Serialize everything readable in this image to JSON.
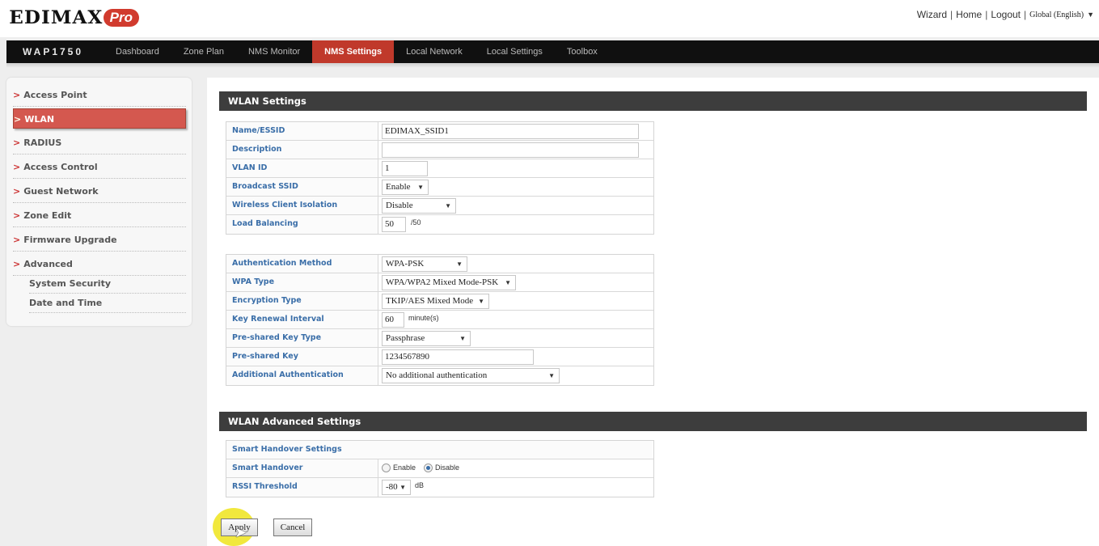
{
  "brand": {
    "name": "EDIMAX",
    "badge": "Pro",
    "brand_color": "#d13b2e"
  },
  "top_links": {
    "wizard": "Wizard",
    "home": "Home",
    "logout": "Logout",
    "separator": "|",
    "language": "Global (English)"
  },
  "nav": {
    "model": "WAP1750",
    "tabs": [
      "Dashboard",
      "Zone Plan",
      "NMS Monitor",
      "NMS Settings",
      "Local Network",
      "Local Settings",
      "Toolbox"
    ],
    "active_tab": "NMS Settings"
  },
  "sidebar": {
    "items": [
      {
        "label": "Access Point"
      },
      {
        "label": "WLAN"
      },
      {
        "label": "RADIUS"
      },
      {
        "label": "Access Control"
      },
      {
        "label": "Guest Network"
      },
      {
        "label": "Zone Edit"
      },
      {
        "label": "Firmware Upgrade"
      },
      {
        "label": "Advanced"
      }
    ],
    "subitems": [
      {
        "label": "System Security"
      },
      {
        "label": "Date and Time"
      }
    ],
    "active": "WLAN",
    "arrow": ">"
  },
  "wlan": {
    "title": "WLAN Settings",
    "basic": [
      {
        "label": "Name/ESSID",
        "value": "EDIMAX_SSID1"
      },
      {
        "label": "Description",
        "value": ""
      },
      {
        "label": "VLAN ID",
        "value": "1"
      },
      {
        "label": "Broadcast SSID",
        "value": "Enable"
      },
      {
        "label": "Wireless Client Isolation",
        "value": "Disable"
      },
      {
        "label": "Load Balancing",
        "value": "50",
        "suffix": "/50"
      }
    ],
    "security": [
      {
        "label": "Authentication Method",
        "value": "WPA-PSK"
      },
      {
        "label": "WPA Type",
        "value": "WPA/WPA2 Mixed Mode-PSK"
      },
      {
        "label": "Encryption Type",
        "value": "TKIP/AES Mixed Mode"
      },
      {
        "label": "Key Renewal Interval",
        "value": "60",
        "suffix": "minute(s)"
      },
      {
        "label": "Pre-shared Key Type",
        "value": "Passphrase"
      },
      {
        "label": "Pre-shared Key",
        "value": "1234567890"
      },
      {
        "label": "Additional Authentication",
        "value": "No additional authentication"
      }
    ]
  },
  "advanced": {
    "title": "WLAN Advanced Settings",
    "smart_handover_heading": "Smart Handover Settings",
    "smart_handover_label": "Smart Handover",
    "enable": "Enable",
    "disable": "Disable",
    "selected": "Disable",
    "rssi_label": "RSSI Threshold",
    "rssi_value": "-80",
    "rssi_unit": "dB"
  },
  "buttons": {
    "apply": "Apply",
    "cancel": "Cancel"
  },
  "colors": {
    "accent_red": "#c0392b",
    "label_blue": "#3a6ea8",
    "section_bar": "#3d3d3d"
  }
}
